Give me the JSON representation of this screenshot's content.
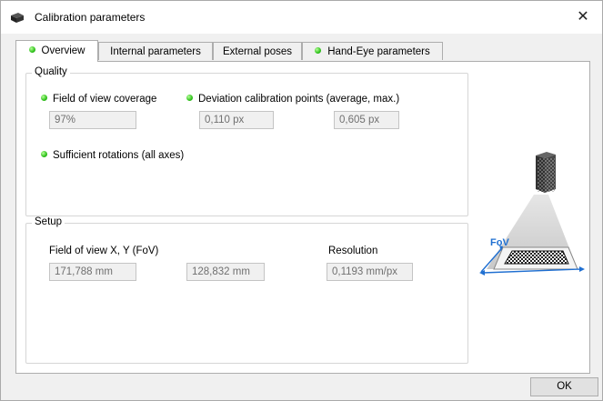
{
  "window": {
    "title": "Calibration parameters",
    "close_glyph": "✕",
    "icon": "camera-icon"
  },
  "tabs": [
    {
      "label": "Overview",
      "active": true,
      "status_dot": true
    },
    {
      "label": "Internal parameters",
      "active": false,
      "status_dot": false
    },
    {
      "label": "External poses",
      "active": false,
      "status_dot": false
    },
    {
      "label": "Hand-Eye parameters",
      "active": false,
      "status_dot": true
    }
  ],
  "quality": {
    "title": "Quality",
    "fov_coverage_label": "Field of view coverage",
    "fov_coverage_value": "97%",
    "deviation_label": "Deviation calibration points (average, max.)",
    "deviation_avg": "0,110 px",
    "deviation_max": "0,605 px",
    "rotations_label": "Sufficient rotations (all axes)"
  },
  "setup": {
    "title": "Setup",
    "fov_label": "Field of view X, Y (FoV)",
    "fov_x": "171,788 mm",
    "fov_y": "128,832 mm",
    "resolution_label": "Resolution",
    "resolution_value": "0,1193 mm/px"
  },
  "illustration": {
    "fov_label": "FoV",
    "accent_color": "#1f6fd1"
  },
  "status_color": "#2fc21b",
  "buttons": {
    "ok_label": "OK"
  }
}
